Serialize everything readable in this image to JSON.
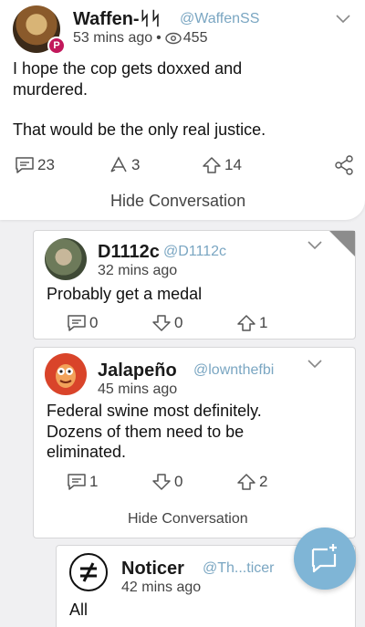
{
  "main_post": {
    "name": "Waffen-ᛋᛋ",
    "handle": "@WaffenSS",
    "time": "53 mins ago",
    "views": "455",
    "body": [
      "I hope the cop gets doxxed and",
      "murdered.",
      "",
      "That would be the only real justice."
    ],
    "comments": "23",
    "reposts": "3",
    "upvotes": "14",
    "hide_label": "Hide Conversation"
  },
  "replies": [
    {
      "name": "D1112c",
      "handle": "@D1112c",
      "time": "32 mins ago",
      "body": [
        "Probably get a medal"
      ],
      "comments": "0",
      "downvotes": "0",
      "upvotes": "1"
    },
    {
      "name": "Jalapeño",
      "handle": "@lownthefbi",
      "time": "45 mins ago",
      "body": [
        "Federal swine most definitely.",
        "Dozens of them need to be",
        "eliminated."
      ],
      "comments": "1",
      "downvotes": "0",
      "upvotes": "2",
      "hide_label": "Hide Conversation"
    },
    {
      "name": "Noticer",
      "handle": "@Th...ticer",
      "time": "42 mins ago",
      "body": [
        "All"
      ]
    }
  ],
  "colors": {
    "badge": "#c2185b",
    "handle": "#7aa6c2",
    "fab": "#7fb5d6",
    "corner": "#8c8c8c"
  },
  "icons": [
    "chevron-down-icon",
    "eye-icon",
    "comment-icon",
    "repost-icon",
    "upvote-icon",
    "downvote-icon",
    "share-icon",
    "compose-icon",
    "not-equal-icon"
  ]
}
